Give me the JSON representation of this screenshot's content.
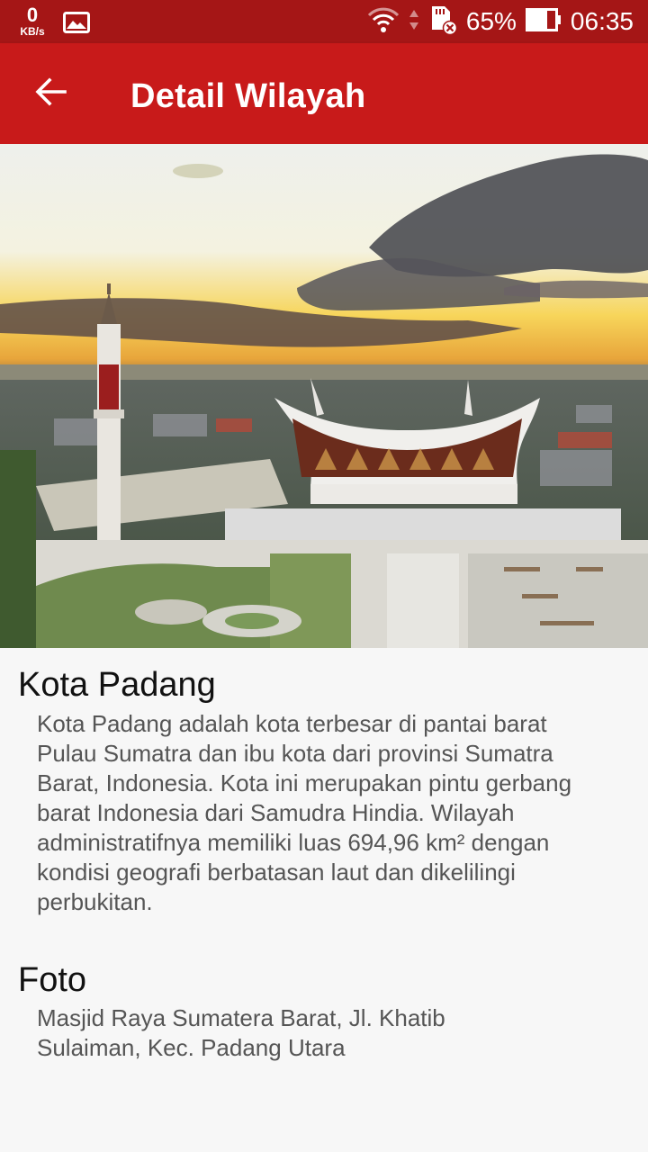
{
  "status_bar": {
    "net_speed_value": "0",
    "net_speed_unit": "KB/s",
    "battery": "65%",
    "time": "06:35"
  },
  "app_bar": {
    "title": "Detail Wilayah"
  },
  "hero": {
    "alt": "Masjid Raya Sumatera Barat"
  },
  "region": {
    "name": "Kota Padang",
    "description": "Kota Padang adalah kota terbesar di pantai barat Pulau Sumatra dan ibu kota dari provinsi Sumatra Barat, Indonesia. Kota ini merupakan pintu gerbang barat Indonesia dari Samudra Hindia. Wilayah administratifnya memiliki luas 694,96 km² dengan kondisi geografi berbatasan laut dan dikelilingi perbukitan."
  },
  "photo": {
    "heading": "Foto",
    "caption": "Masjid Raya Sumatera Barat, Jl. Khatib Sulaiman, Kec. Padang Utara"
  },
  "colors": {
    "status_bar": "#a51616",
    "app_bar": "#c81a1a",
    "background": "#f7f7f7"
  }
}
